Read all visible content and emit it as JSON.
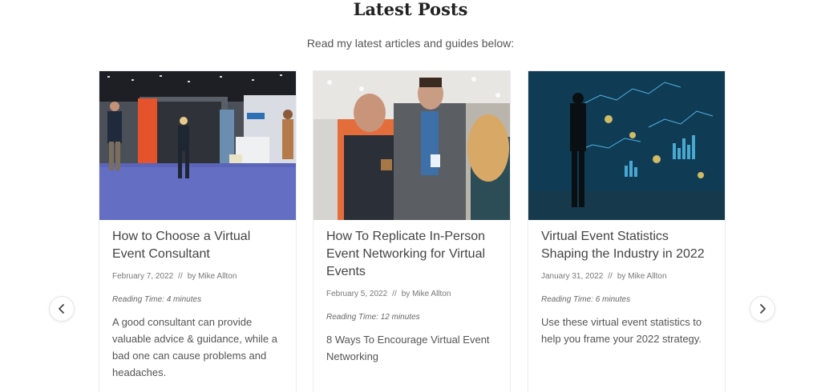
{
  "section": {
    "title": "Latest Posts",
    "subtitle": "Read my latest articles and guides below:"
  },
  "posts": [
    {
      "title": "How to Choose a Virtual Event Consultant",
      "date": "February 7, 2022",
      "separator": "//",
      "by": "by",
      "author": "Mike Allton",
      "reading_time": "Reading Time: 4 minutes",
      "excerpt": "A good consultant can provide valuable advice & guidance, while a bad one can cause problems and headaches."
    },
    {
      "title": "How To Replicate In-Person Event Networking for Virtual Events",
      "date": "February 5, 2022",
      "separator": "//",
      "by": "by",
      "author": "Mike Allton",
      "reading_time": "Reading Time: 12 minutes",
      "excerpt": "8 Ways To Encourage Virtual Event Networking"
    },
    {
      "title": "Virtual Event Statistics Shaping the Industry in 2022",
      "date": "January 31, 2022",
      "separator": "//",
      "by": "by",
      "author": "Mike Allton",
      "reading_time": "Reading Time: 6 minutes",
      "excerpt": "Use these virtual event statistics to help you frame your 2022 strategy."
    }
  ],
  "nav": {
    "prev_icon": "chevron-left-icon",
    "next_icon": "chevron-right-icon"
  }
}
